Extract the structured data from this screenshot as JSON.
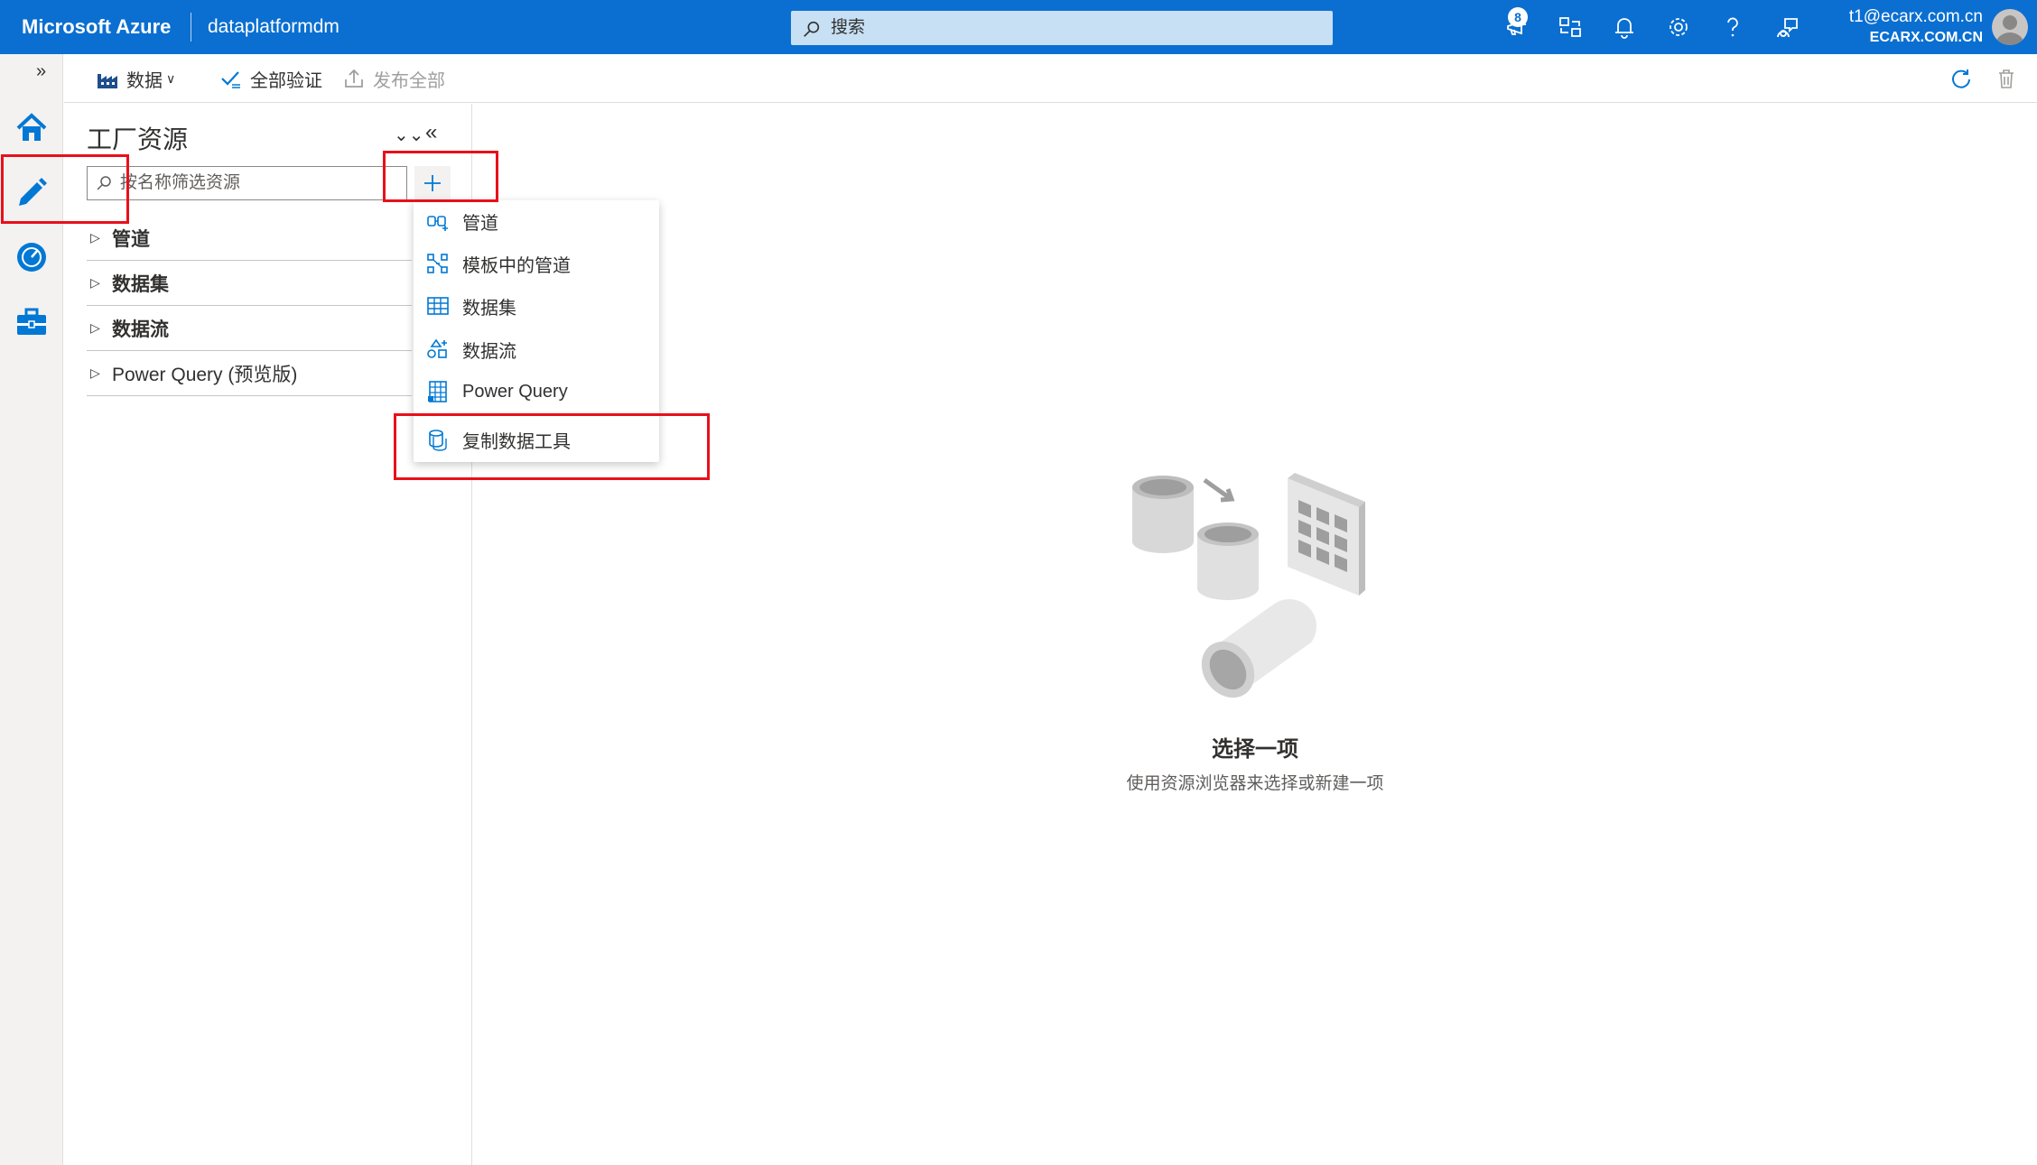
{
  "topbar": {
    "brand": "Microsoft Azure",
    "factory_name": "dataplatformdm",
    "search_placeholder": "搜索",
    "notification_count": "8",
    "user_email": "t1@ecarx.com.cn",
    "user_org": "ECARX.COM.CN",
    "icons": [
      "feedback-icon",
      "directory-icon",
      "bell-icon",
      "gear-icon",
      "help-icon",
      "person-feedback-icon"
    ]
  },
  "rail": {
    "expand_label": "»",
    "items": [
      "home-icon",
      "author-pencil-icon",
      "monitor-icon",
      "manage-toolbox-icon"
    ]
  },
  "toolbar": {
    "data_label": "数据",
    "validate_all_label": "全部验证",
    "publish_all_label": "发布全部"
  },
  "resources": {
    "title": "工厂资源",
    "filter_placeholder": "按名称筛选资源",
    "tree": [
      {
        "label": "管道"
      },
      {
        "label": "数据集"
      },
      {
        "label": "数据流"
      },
      {
        "label": "Power Query (预览版)"
      }
    ]
  },
  "add_menu": {
    "items": [
      {
        "label": "管道",
        "icon": "pipeline-icon"
      },
      {
        "label": "模板中的管道",
        "icon": "template-pipeline-icon"
      },
      {
        "label": "数据集",
        "icon": "dataset-table-icon"
      },
      {
        "label": "数据流",
        "icon": "dataflow-icon"
      },
      {
        "label": "Power Query",
        "icon": "power-query-icon"
      },
      {
        "label": "复制数据工具",
        "icon": "copy-data-tool-icon"
      }
    ]
  },
  "empty_state": {
    "title": "选择一项",
    "subtitle": "使用资源浏览器来选择或新建一项"
  },
  "colors": {
    "topbar_bg": "#0a6fd1",
    "highlight": "#e8101a",
    "accent": "#0078d4"
  }
}
